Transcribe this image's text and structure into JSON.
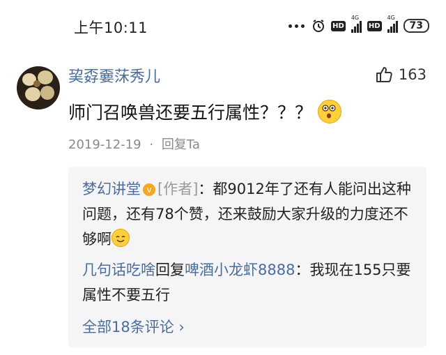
{
  "status_bar": {
    "time": "上午10:11",
    "network_1": "4G",
    "network_2": "4G",
    "hd_1": "HD",
    "hd_2": "HD",
    "battery": "73"
  },
  "comment": {
    "username": "巭孬嫑莯秀儿",
    "like_count": "163",
    "text": "师门召唤兽还要五行属性？？？",
    "date": "2019-12-19",
    "separator": "·",
    "reply_action": "回复Ta"
  },
  "replies": [
    {
      "author": "梦幻讲堂",
      "author_badge": "v",
      "role_tag": "[作者]",
      "colon": "：",
      "text": "都9012年了还有人能问出这种问题，还有78个赞，还来鼓励大家升级的力度还不够啊"
    },
    {
      "author": "几句话吃啥",
      "reply_word": "回复",
      "target": "啤酒小龙虾8888",
      "colon": "：",
      "text": "我现在155只要属性不要五行"
    }
  ],
  "view_all": "全部18条评论",
  "view_all_chevron": "›"
}
